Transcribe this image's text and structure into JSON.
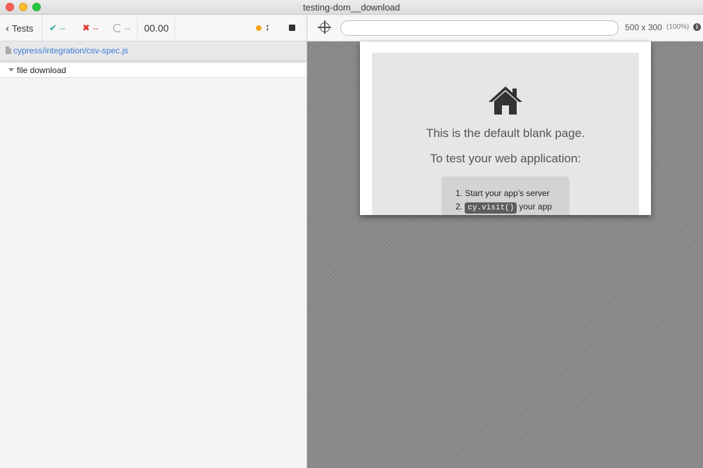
{
  "window": {
    "title": "testing-dom__download"
  },
  "reporter": {
    "back_label": "Tests",
    "passed": "--",
    "failed": "--",
    "pending": "--",
    "duration": "00.00",
    "spec_path": "cypress/integration/csv-spec.js",
    "suite_title": "file download"
  },
  "aut": {
    "url_value": "",
    "viewport_size": "500 x 300",
    "viewport_scale": "(100%)",
    "blank_title": "This is the default blank page.",
    "blank_subtitle": "To test your web application:",
    "step1_num": "1.",
    "step1_text": "Start your app's server",
    "step2_num": "2.",
    "step2_code": "cy.visit()",
    "step2_text": "your app"
  },
  "icons": {
    "back": "chevron-left-icon",
    "passed": "check-icon",
    "failed": "x-icon",
    "pending": "circle-notch-icon",
    "running": "status-dot-icon",
    "scroll": "arrows-vertical-icon",
    "stop": "stop-icon",
    "selector": "crosshair-icon",
    "info": "info-icon",
    "file": "file-icon",
    "suite": "caret-down-icon",
    "home": "house-icon"
  },
  "colors": {
    "passed": "#2aa198",
    "failed": "#e0342e",
    "running": "#f4a51c",
    "link": "#3a7bd5"
  }
}
